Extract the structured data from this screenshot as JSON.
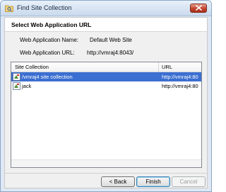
{
  "window": {
    "title": "Find Site Collection",
    "icon": "search-folder-icon",
    "close_icon": "close-icon"
  },
  "header": {
    "title": "Select Web Application URL"
  },
  "fields": {
    "web_app_name_label": "Web Application Name:",
    "web_app_name_value": "Default Web Site",
    "web_app_url_label": "Web Application URL:",
    "web_app_url_value": "http://vmraj4:8043/"
  },
  "list": {
    "columns": [
      "Site Collection",
      "URL"
    ],
    "rows": [
      {
        "name": "/vmraj4 site collection",
        "url": "http://vmraj4:80",
        "selected": true,
        "icon": "site-collection-icon"
      },
      {
        "name": "jack",
        "url": "http://vmraj4:80",
        "selected": false,
        "icon": "site-collection-icon"
      }
    ]
  },
  "buttons": {
    "back": "< Back",
    "finish": "Finish",
    "cancel": "Cancel"
  },
  "colors": {
    "selection": "#3b6fd1",
    "titlebar": "#c9d9ec",
    "close": "#c2452e"
  }
}
